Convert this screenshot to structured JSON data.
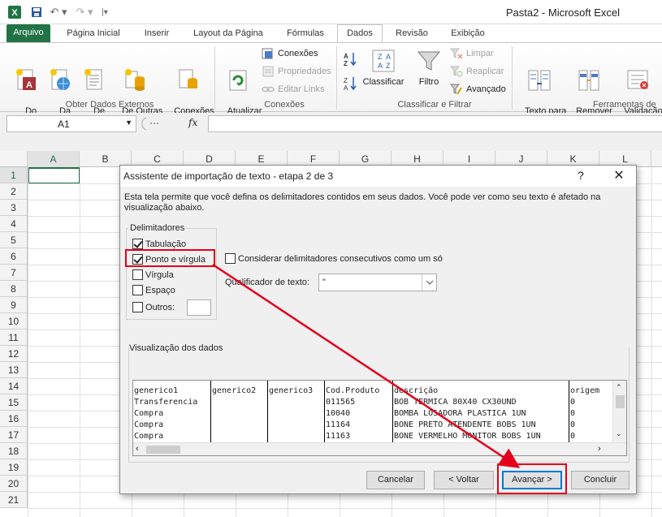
{
  "window": {
    "title": "Pasta2  -  Microsoft Excel"
  },
  "tabs": [
    {
      "label": "Arquivo"
    },
    {
      "label": "Página Inicial"
    },
    {
      "label": "Inserir"
    },
    {
      "label": "Layout da Página"
    },
    {
      "label": "Fórmulas"
    },
    {
      "label": "Dados"
    },
    {
      "label": "Revisão"
    },
    {
      "label": "Exibição"
    }
  ],
  "ribbon": {
    "group1": {
      "label": "Obter Dados Externos",
      "buttons": [
        {
          "label": "Do\nAccess"
        },
        {
          "label": "Da\nWeb"
        },
        {
          "label": "De\nTexto"
        },
        {
          "label": "De Outras\nFontes ▾"
        },
        {
          "label": "Conexões\nExistentes"
        }
      ]
    },
    "group2": {
      "label": "Conexões",
      "big": {
        "label": "Atualizar\ntudo ▾"
      },
      "small": [
        {
          "label": "Conexões"
        },
        {
          "label": "Propriedades"
        },
        {
          "label": "Editar Links"
        }
      ]
    },
    "group3": {
      "label": "Classificar e Filtrar",
      "classificar": {
        "label": "Classificar"
      },
      "filtro": {
        "label": "Filtro"
      },
      "small": [
        {
          "label": "Limpar"
        },
        {
          "label": "Reaplicar"
        },
        {
          "label": "Avançado"
        }
      ]
    },
    "group4": {
      "label": "Ferramentas de",
      "buttons": [
        {
          "label": "Texto para\ncolunas"
        },
        {
          "label": "Remover\nDuplicatas"
        },
        {
          "label": "Validação\nde Dados ▾"
        }
      ]
    }
  },
  "formula_bar": {
    "name_box": "A1",
    "fx": "fx",
    "value": ""
  },
  "grid": {
    "columns": [
      "A",
      "B",
      "C",
      "D",
      "E",
      "F",
      "G",
      "H",
      "I",
      "J",
      "K",
      "L"
    ],
    "rows": [
      "1",
      "2",
      "3",
      "4",
      "5",
      "6",
      "7",
      "8",
      "9",
      "10",
      "11",
      "12",
      "13",
      "14",
      "15",
      "16",
      "17",
      "18",
      "19",
      "20",
      "21"
    ]
  },
  "dialog": {
    "title": "Assistente de importação de texto - etapa 2 de 3",
    "help": "?",
    "close": "✕",
    "description": "Esta tela permite que você defina os delimitadores contidos em seus dados. Você pode ver como seu texto é afetado na visualização abaixo.",
    "delimiters_label": "Delimitadores",
    "delimiters": [
      {
        "label": "Tabulação",
        "checked": true
      },
      {
        "label": "Ponto e vírgula",
        "checked": true
      },
      {
        "label": "Vírgula",
        "checked": false
      },
      {
        "label": "Espaço",
        "checked": false
      },
      {
        "label": "Outros:",
        "checked": false
      }
    ],
    "consecutive_label": "Considerar delimitadores consecutivos como um só",
    "qualifier_label": "Qualificador de texto:",
    "qualifier_value": "\"",
    "preview_label": "Visualização dos dados",
    "preview": {
      "headers": [
        "generico1",
        "generico2",
        "generico3",
        "Cod.Produto",
        "descrição",
        "origem"
      ],
      "rows": [
        [
          "Transferencia",
          "",
          "",
          "011565",
          "BOB TERMICA 80X40 CX30UND",
          "0"
        ],
        [
          "Compra",
          "",
          "",
          "10040",
          "BOMBA LOSADORA PLASTICA 1UN",
          "0"
        ],
        [
          "Compra",
          "",
          "",
          "11164",
          "BONE PRETO ATENDENTE  BOBS 1UN",
          "0"
        ],
        [
          "Compra",
          "",
          "",
          "11163",
          "BONE VERMELHO MONITOR BOBS 1UN",
          "0"
        ]
      ]
    },
    "buttons": {
      "cancel": "Cancelar",
      "back": "< Voltar",
      "next": "Avançar >",
      "finish": "Concluir"
    }
  },
  "colors": {
    "excel_green": "#217346",
    "annotation_red": "#e3001b"
  }
}
